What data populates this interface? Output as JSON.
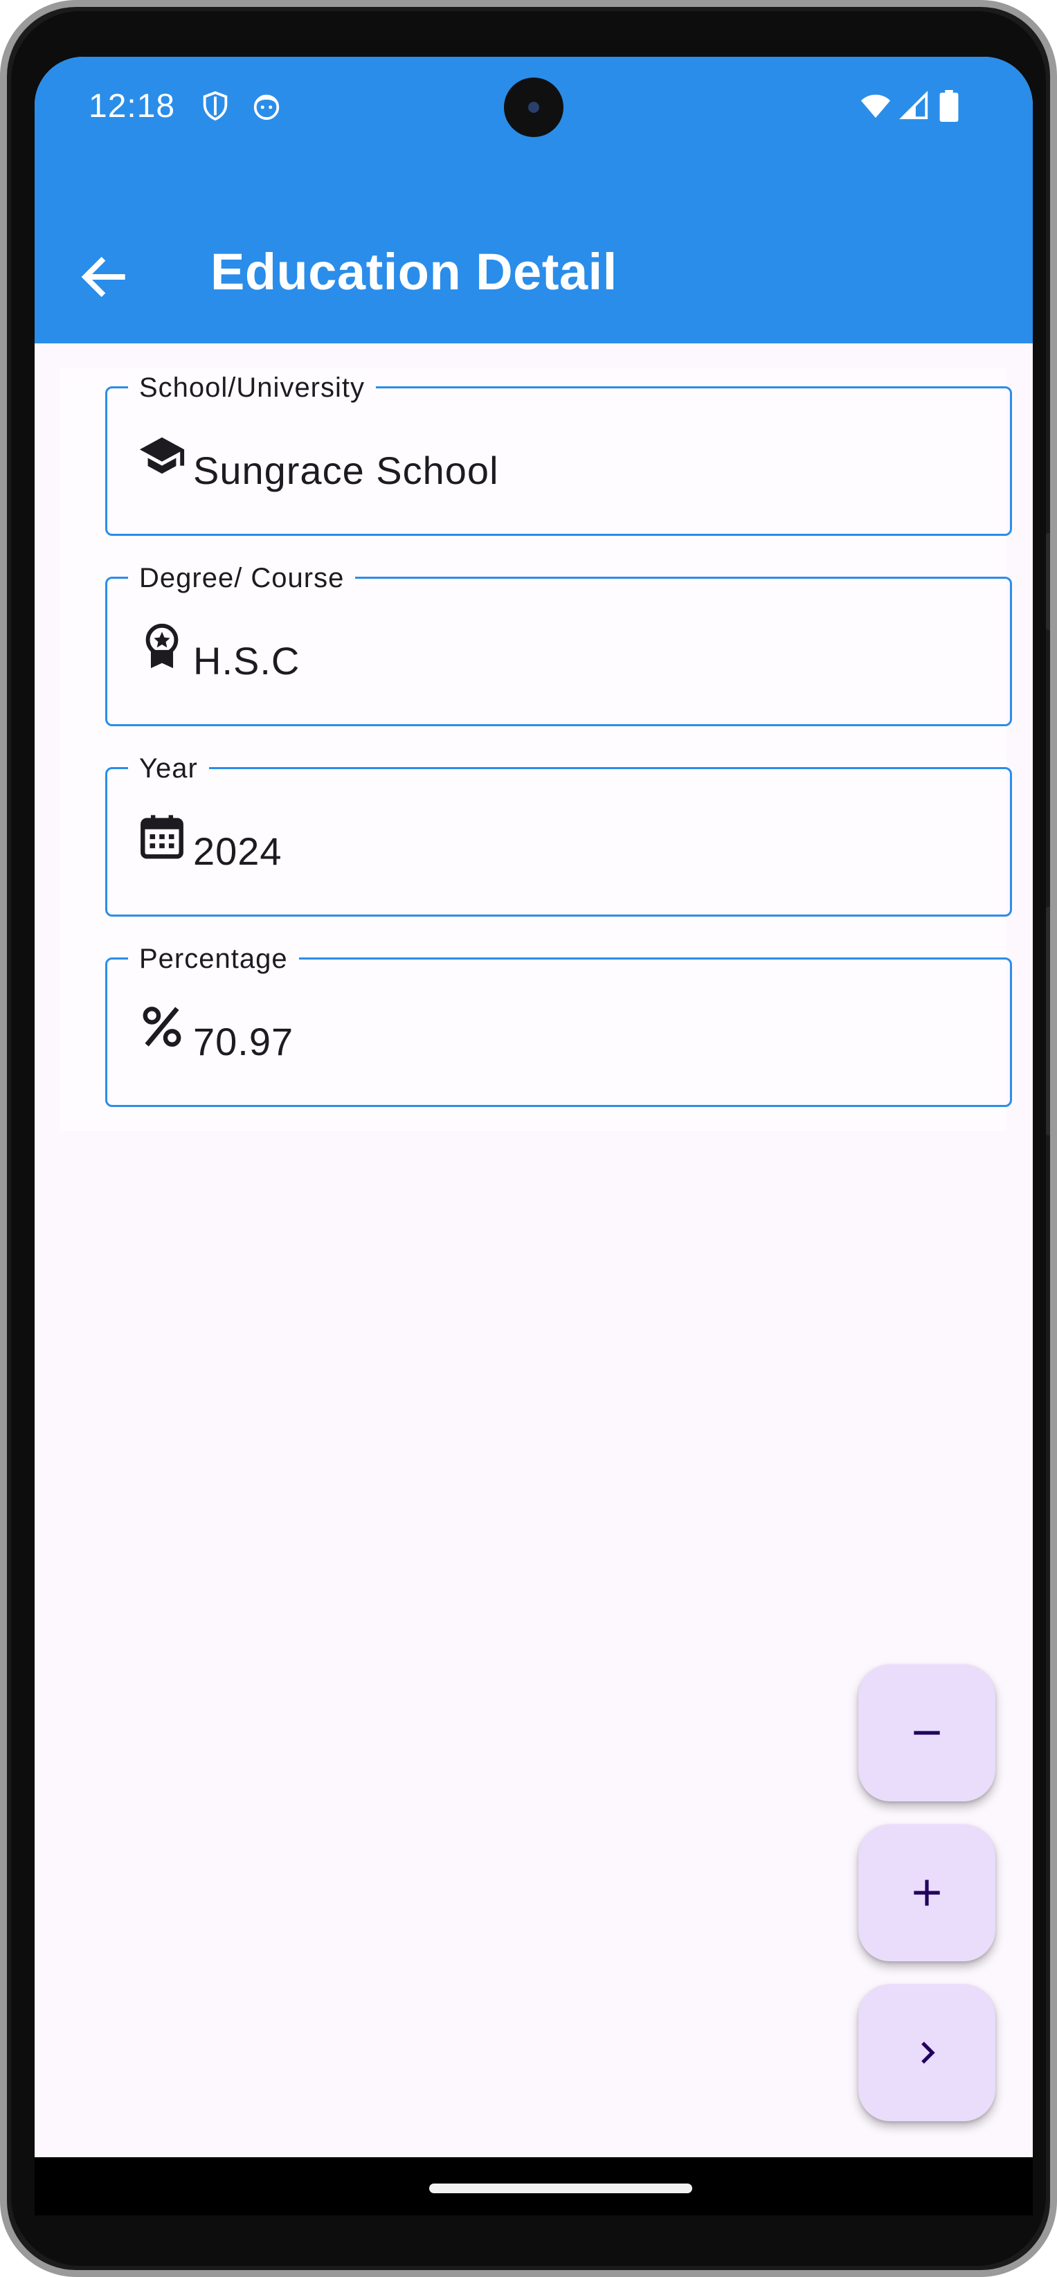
{
  "status_bar": {
    "time": "12:18",
    "left_icons": [
      "shield-icon",
      "face-icon"
    ],
    "right_icons": [
      "wifi-icon",
      "signal-icon",
      "battery-icon"
    ]
  },
  "app_bar": {
    "title": "Education Detail",
    "back_icon": "arrow-left-icon",
    "color": "#2a8de9"
  },
  "form": {
    "fields": [
      {
        "label": "School/University",
        "value": "Sungrace School",
        "icon": "graduation-cap-icon"
      },
      {
        "label": "Degree/ Course",
        "value": "H.S.C",
        "icon": "award-badge-icon"
      },
      {
        "label": "Year",
        "value": "2024",
        "icon": "calendar-icon"
      },
      {
        "label": "Percentage",
        "value": "70.97",
        "icon": "percent-icon"
      }
    ]
  },
  "fabs": [
    {
      "icon": "minus-icon"
    },
    {
      "icon": "plus-icon"
    },
    {
      "icon": "chevron-right-icon"
    }
  ],
  "colors": {
    "accent": "#2a8de9",
    "fab_background": "#e9ddfb",
    "fab_icon": "#21005d",
    "screen_background": "#fdf7fe"
  }
}
